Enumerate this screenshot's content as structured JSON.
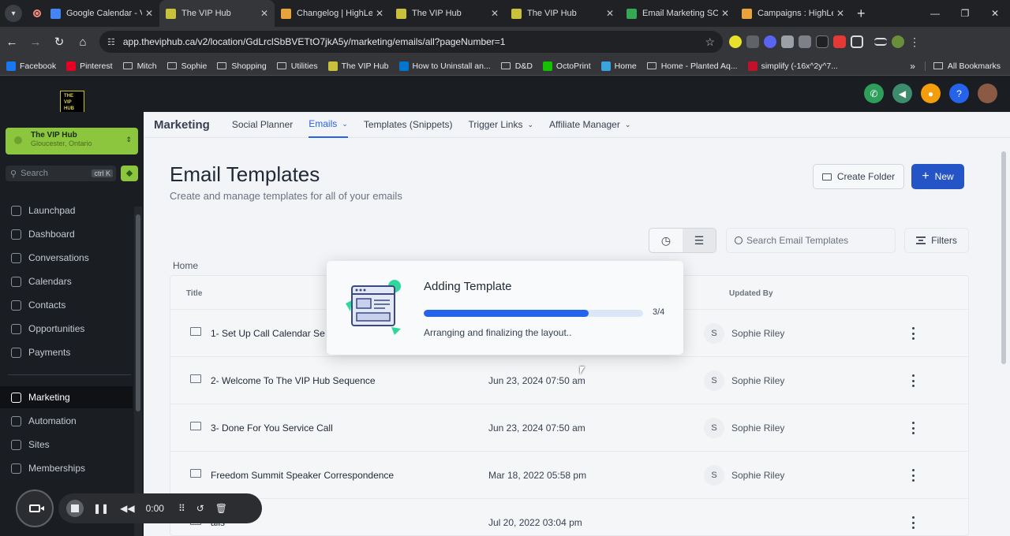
{
  "browser": {
    "tabs": [
      {
        "title": "Google Calendar - V",
        "favicon_color": "#4285f4",
        "active": false
      },
      {
        "title": "The VIP Hub",
        "favicon_color": "#c9c13b",
        "active": true
      },
      {
        "title": "Changelog | HighLe",
        "favicon_color": "#e8a33b",
        "active": false
      },
      {
        "title": "The VIP Hub",
        "favicon_color": "#c9c13b",
        "active": false
      },
      {
        "title": "The VIP Hub",
        "favicon_color": "#c9c13b",
        "active": false
      },
      {
        "title": "Email Marketing SO",
        "favicon_color": "#34a853",
        "active": false
      },
      {
        "title": "Campaigns : HighLe",
        "favicon_color": "#e8a33b",
        "active": false
      }
    ],
    "url": "app.theviphub.ca/v2/location/GdLrclSbBVETtO7jkA5y/marketing/emails/all?pageNumber=1",
    "bookmarks": [
      {
        "label": "Facebook",
        "type": "site",
        "color": "#1877f2"
      },
      {
        "label": "Pinterest",
        "type": "site",
        "color": "#e60023"
      },
      {
        "label": "Mitch",
        "type": "folder"
      },
      {
        "label": "Sophie",
        "type": "folder"
      },
      {
        "label": "Shopping",
        "type": "folder"
      },
      {
        "label": "Utilities",
        "type": "folder"
      },
      {
        "label": "The VIP Hub",
        "type": "site",
        "color": "#c9c13b"
      },
      {
        "label": "How to Uninstall an...",
        "type": "site",
        "color": "#0076ce"
      },
      {
        "label": "D&D",
        "type": "folder"
      },
      {
        "label": "OctoPrint",
        "type": "site",
        "color": "#13c100"
      },
      {
        "label": "Home",
        "type": "site",
        "color": "#3ba3e0"
      },
      {
        "label": "Home - Planted Aq...",
        "type": "folder"
      },
      {
        "label": "simplify (-16x^2y^7...",
        "type": "site",
        "color": "#c3102b"
      }
    ],
    "all_bookmarks_label": "All Bookmarks"
  },
  "app": {
    "logo_text": "THE VIP HUB",
    "location": {
      "name": "The VIP Hub",
      "city": "Gloucester, Ontario"
    },
    "search": {
      "placeholder": "Search",
      "shortcut": "ctrl K"
    },
    "nav": [
      {
        "label": "Launchpad",
        "active": false
      },
      {
        "label": "Dashboard",
        "active": false
      },
      {
        "label": "Conversations",
        "active": false
      },
      {
        "label": "Calendars",
        "active": false
      },
      {
        "label": "Contacts",
        "active": false
      },
      {
        "label": "Opportunities",
        "active": false
      },
      {
        "label": "Payments",
        "active": false
      },
      {
        "label": "Marketing",
        "active": true
      },
      {
        "label": "Automation",
        "active": false
      },
      {
        "label": "Sites",
        "active": false
      },
      {
        "label": "Memberships",
        "active": false
      }
    ],
    "header_actions_colors": {
      "phone": "#2e9e5b",
      "megaphone": "#3d8c6e",
      "bell": "#f59e0b",
      "help": "#2563eb"
    }
  },
  "subnav": {
    "section": "Marketing",
    "items": [
      {
        "label": "Social Planner",
        "dropdown": false,
        "active": false
      },
      {
        "label": "Emails",
        "dropdown": true,
        "active": true
      },
      {
        "label": "Templates (Snippets)",
        "dropdown": false,
        "active": false
      },
      {
        "label": "Trigger Links",
        "dropdown": true,
        "active": false
      },
      {
        "label": "Affiliate Manager",
        "dropdown": true,
        "active": false
      }
    ]
  },
  "page": {
    "title": "Email Templates",
    "subtitle": "Create and manage templates for all of your emails",
    "create_folder_label": "Create Folder",
    "new_label": "New",
    "search_placeholder": "Search Email Templates",
    "filters_label": "Filters",
    "breadcrumb": "Home"
  },
  "table": {
    "columns": {
      "title": "Title",
      "updated_by": "Updated By"
    },
    "rows": [
      {
        "title": "1- Set Up Call Calendar Se",
        "updated": "",
        "initial": "S",
        "by": "Sophie Riley"
      },
      {
        "title": "2- Welcome To The VIP Hub Sequence",
        "updated": "Jun 23, 2024 07:50 am",
        "initial": "S",
        "by": "Sophie Riley"
      },
      {
        "title": "3- Done For You Service Call",
        "updated": "Jun 23, 2024 07:50 am",
        "initial": "S",
        "by": "Sophie Riley"
      },
      {
        "title": "Freedom Summit Speaker Correspondence",
        "updated": "Mar 18, 2022 05:58 pm",
        "initial": "S",
        "by": "Sophie Riley"
      },
      {
        "title": "ails",
        "updated": "Jul 20, 2022 03:04 pm",
        "initial": "",
        "by": ""
      }
    ]
  },
  "modal": {
    "title": "Adding Template",
    "progress": 0.75,
    "step": "3/4",
    "message": "Arranging and finalizing the layout.."
  },
  "recorder": {
    "time": "0:00"
  },
  "accent": "#2563eb"
}
